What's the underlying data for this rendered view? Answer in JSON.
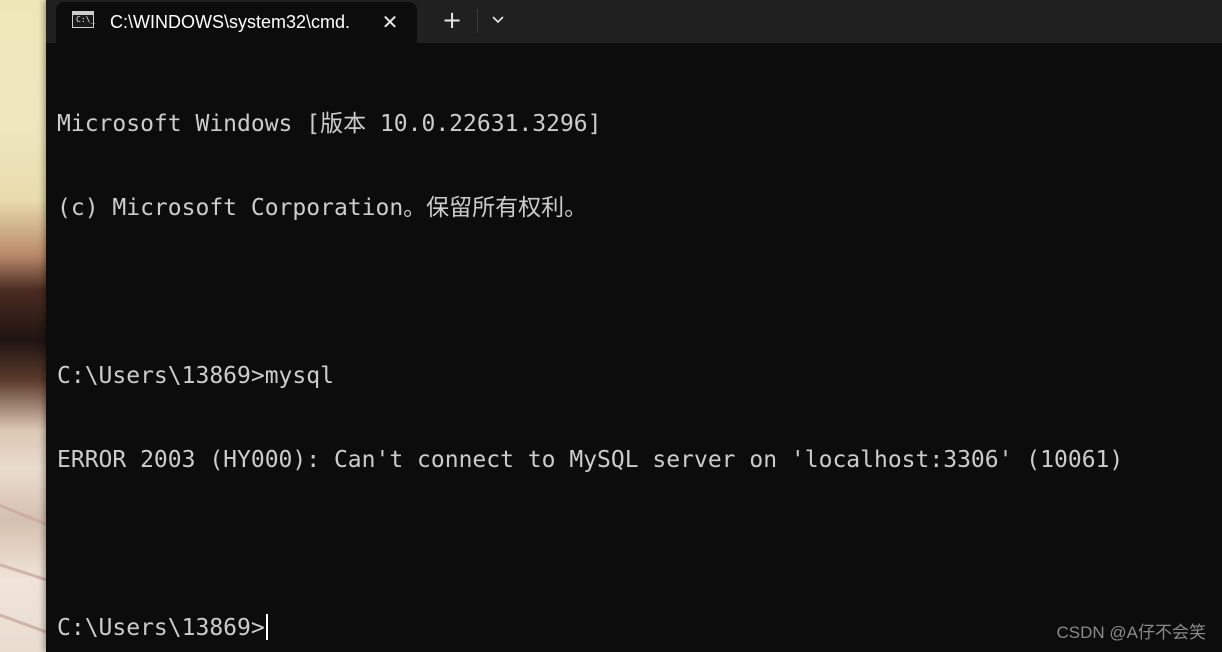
{
  "window": {
    "tab": {
      "icon": "cmd-icon",
      "title": "C:\\WINDOWS\\system32\\cmd.",
      "close_symbol": "✕"
    },
    "new_tab_symbol": "+",
    "dropdown_icon": "chevron-down-icon"
  },
  "terminal": {
    "lines": [
      "Microsoft Windows [版本 10.0.22631.3296]",
      "(c) Microsoft Corporation。保留所有权利。",
      "",
      "C:\\Users\\13869>mysql",
      "ERROR 2003 (HY000): Can't connect to MySQL server on 'localhost:3306' (10061)",
      "",
      "C:\\Users\\13869>"
    ]
  },
  "watermark": "CSDN @A仔不会笑",
  "colors": {
    "terminal_bg": "#0c0c0c",
    "tabbar_bg": "#202020",
    "text": "#cccccc"
  }
}
